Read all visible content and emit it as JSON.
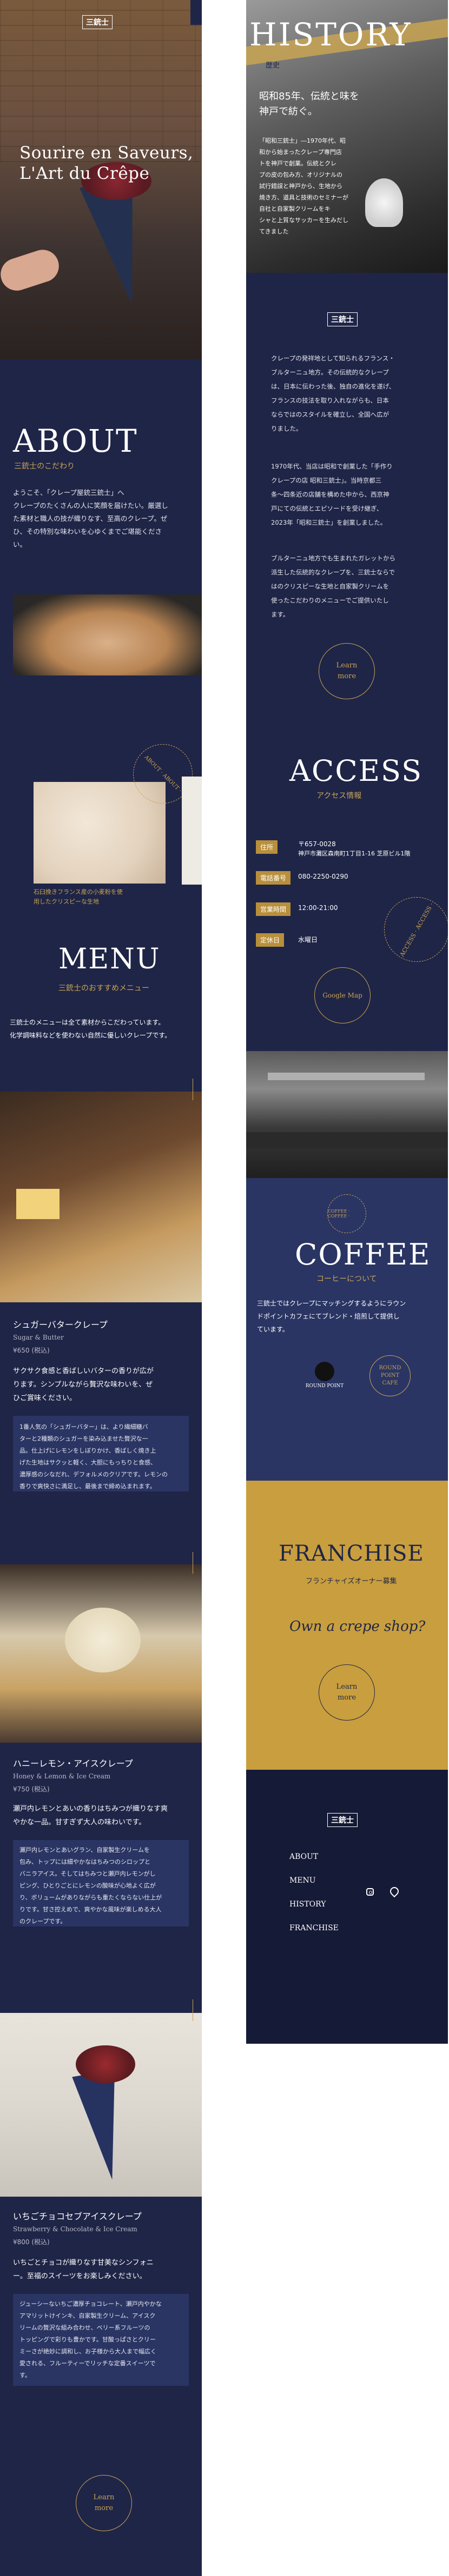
{
  "brand": {
    "logo_text": "三銃士"
  },
  "hero": {
    "title_line1": "Sourire en Saveurs,",
    "title_line2": "L'Art du Crêpe"
  },
  "history": {
    "title": "HISTORY",
    "subtitle": "歴史",
    "tagline_line1": "昭和85年、伝統と味を",
    "tagline_line2": "神戸で紡ぐ。",
    "overlay_text": "「昭和三銃士」―1970年代、昭\n和から始まったクレープ専門店\nトを神戸で創業。伝統とクレ\nプの皮の包み方、オリジナルの\n試行錯誤と神戸から、生地から\n焼き方、道具と技術のセミナーが\n自社と自家製クリームをキ\nシャと上質なサッカーを生みだし\nてきました",
    "paragraph1": "クレープの発祥地として知られるフランス・\nブルターニュ地方。その伝統的なクレープ\nは、日本に伝わった後、独自の進化を遂げ、\nフランスの技法を取り入れながらも、日本\nならではのスタイルを確立し、全国へ広が\nりました。",
    "paragraph2": "1970年代、当店は昭和で創業した「手作り\nクレープの店 昭和三銃士」。当時京都三\n条～四条近の店舗を構めた中から、西京神\n戸にての伝統とエピソードを受け継ぎ、\n2023年「昭和三銃士」を創業しました。",
    "paragraph3": "ブルターニュ地方でも生まれたガレットから\n派生した伝統的なクレープを、三銃士ならで\nはのクリスピーな生地と自家製クリームを\n使ったこだわりのメニューでご提供いたし\nます。",
    "learn_more_line1": "Learn",
    "learn_more_line2": "more"
  },
  "about": {
    "title": "ABOUT",
    "subtitle": "三銃士のこだわり",
    "paragraph": "ようこそ、「クレープ屋銃三銃士」へ\nクレープのたくさんの人に笑顔を届けたい。厳選し\nた素材と職人の技が織りなす、至高のクレープ。ぜ\nひ、その特別な味わいを心ゆくまでご堪能くださ\nい。",
    "caption_line1": "石臼挽きフランス産の小麦粉を使",
    "caption_line2": "用したクリスピーな生地",
    "rotating_text": "ABOUT · ABOUT ·"
  },
  "access": {
    "title": "ACCESS",
    "subtitle": "アクセス情報",
    "address_badge": "住所",
    "address_line1": "〒657-0028",
    "address_line2": "神戸市灘区森南町1丁目1-16 芝原ビル1階",
    "phone_badge": "電話番号",
    "phone": "080-2250-0290",
    "hours_badge": "営業時間",
    "hours": "12:00-21:00",
    "closed_badge": "定休日",
    "closed": "水曜日",
    "map_button": "Google Map",
    "rotating_text": "ACCESS · ACCESS ·"
  },
  "menu": {
    "title": "MENU",
    "subtitle": "三銃士のおすすめメニュー",
    "intro_line1": "三銃士のメニューは全て素材からこだわっています。",
    "intro_line2": "化学調味料などを使わない自然に優しいクレープです。",
    "items": [
      {
        "name": "シュガーバタークレープ",
        "name_en": "Sugar & Butter",
        "price": "¥650 (税込)",
        "lead": "サクサク食感と香ばしいバターの香りが広が\nります。シンプルながら贅沢な味わいを、ぜ\nひご賞味ください。",
        "desc": "1番人気の「シュガーバター」は、より繊細糖バ\nターと2種類のシュガーを染み込ませた贅沢な一\n品。仕上げにレモンをしぼりかけ、香ばしく焼き上\nげた生地はサクッと軽く、大胆にもっちりと食感、\n濃厚感のシなだれ、デフォルメのクリアです。レモンの\n香りで爽快さに満足し、最後まで締め込まれます。"
      },
      {
        "name": "ハニーレモン・アイスクレープ",
        "name_en": "Honey & Lemon & Ice Cream",
        "price": "¥750 (税込)",
        "lead": "瀬戸内レモンとあいの香りはちみつが織りなす爽\nやかな一品。甘すぎず大人の味わいです。",
        "desc": "瀬戸内レモンとあいグラン、自家製生クリームを\n包み、トップには細やかなはちみつのシロップと\nバニラアイス。そしてはちみつと瀬戸内レモンがし\nピング、ひとりごとにレモンの酸味が心地よく広が\nり、ボリュームがありながらも重たくならない仕上が\nりです。甘さ控えめで、爽やかな風味が楽しめる大人\nのクレープです。"
      },
      {
        "name": "いちごチョコセブアイスクレープ",
        "name_en": "Strawberry & Chocolate & Ice Cream",
        "price": "¥800 (税込)",
        "lead": "いちごとチョコが織りなす甘美なシンフォニ\nー。至福のスイーツをお楽しみください。",
        "desc": "ジューシーないちご濃厚チョコレート、瀬戸内やかな\nアマリットけインキ、自家製生クリーム、アイスク\nリームの贅沢な組み合わせ、ベリー系フルーツの\nトッピングで彩りも豊かです。甘酸っぱさとクリー\nミーさが絶妙に調和し、お子様から大人まで幅広く\n愛される、フルーティーでリッチな定番スイーツで\nす。"
      }
    ],
    "learn_more_line1": "Learn",
    "learn_more_line2": "more"
  },
  "coffee": {
    "title": "COFFEE",
    "subtitle": "コーヒーについて",
    "paragraph": "三銃士ではクレープにマッチングするようにラウン\nドポイントカフェにてブレンド・焙煎して提供し\nています。",
    "partner_logo_text": "ROUND POINT",
    "partner_badge_line1": "ROUND",
    "partner_badge_line2": "POINT",
    "partner_badge_line3": "CAFE",
    "rotating_text": "COFFEE · COFFEE ·"
  },
  "franchise": {
    "title": "FRANCHISE",
    "subtitle": "フランチャイズオーナー募集",
    "script_text": "Own a crepe shop?",
    "learn_more_line1": "Learn",
    "learn_more_line2": "more"
  },
  "footer": {
    "nav": [
      "ABOUT",
      "MENU",
      "HISTORY",
      "FRANCHISE"
    ]
  },
  "colors": {
    "navy": "#1f2547",
    "dark_navy": "#151a36",
    "gold": "#c9a453",
    "mustard": "#c89e3e"
  }
}
